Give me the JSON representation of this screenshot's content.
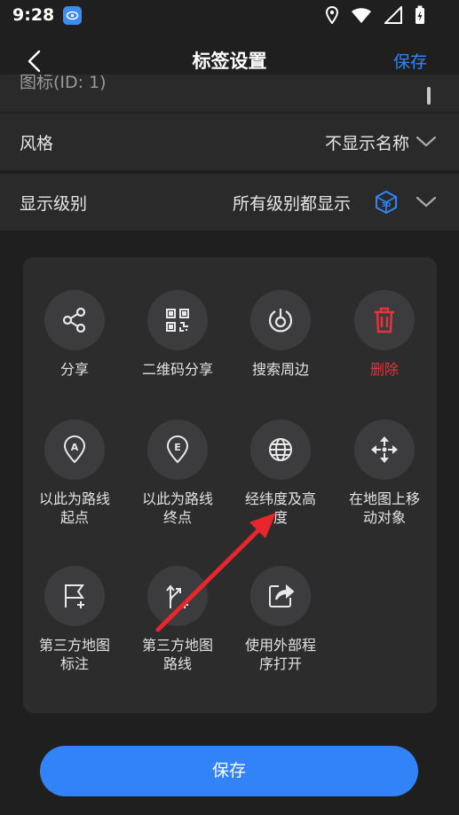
{
  "status_bar": {
    "time": "9:28"
  },
  "header": {
    "title": "标签设置",
    "save_label": "保存"
  },
  "settings": {
    "partial_row_label": "图标(ID: 1)",
    "style_label": "风格",
    "style_value": "不显示名称",
    "level_label": "显示级别",
    "level_value": "所有级别都显示"
  },
  "actions": [
    {
      "label": "分享",
      "icon": "share-icon"
    },
    {
      "label": "二维码分享",
      "icon": "qr-code-icon"
    },
    {
      "label": "搜索周边",
      "icon": "search-nearby-icon"
    },
    {
      "label": "删除",
      "icon": "trash-icon",
      "color": "#e8333a"
    },
    {
      "label": "以此为路线\n起点",
      "icon": "route-start-icon"
    },
    {
      "label": "以此为路线\n终点",
      "icon": "route-end-icon"
    },
    {
      "label": "经纬度及高\n度",
      "icon": "globe-icon"
    },
    {
      "label": "在地图上移\n动对象",
      "icon": "move-icon"
    },
    {
      "label": "第三方地图\n标注",
      "icon": "flag-plus-icon"
    },
    {
      "label": "第三方地图\n路线",
      "icon": "route-plus-icon"
    },
    {
      "label": "使用外部程\n序打开",
      "icon": "open-external-icon"
    }
  ],
  "footer": {
    "save_label": "保存"
  },
  "colors": {
    "accent": "#3183f7",
    "danger": "#e8333a",
    "annotation_arrow": "#e8262b"
  }
}
